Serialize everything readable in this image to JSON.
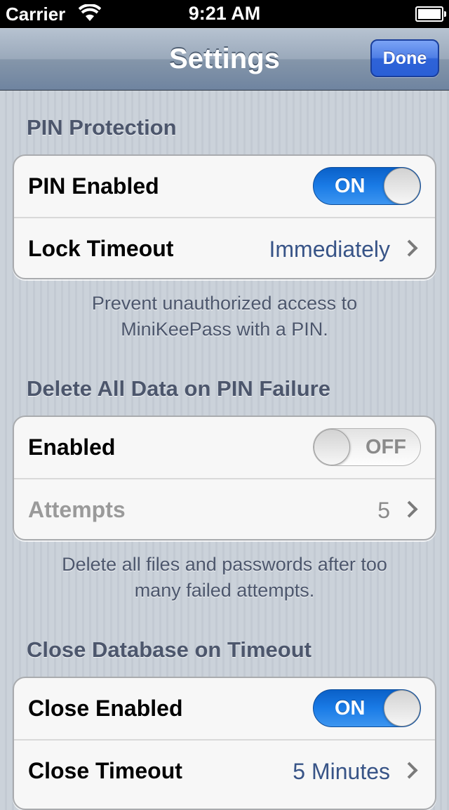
{
  "status_bar": {
    "carrier": "Carrier",
    "time": "9:21 AM",
    "wifi_icon": "wifi-icon",
    "battery_icon": "battery-icon"
  },
  "nav_bar": {
    "title": "Settings",
    "done_label": "Done"
  },
  "sections": {
    "pin": {
      "header": "PIN Protection",
      "pin_enabled_label": "PIN Enabled",
      "pin_enabled_state": "ON",
      "lock_timeout_label": "Lock Timeout",
      "lock_timeout_value": "Immediately",
      "footer_line1": "Prevent unauthorized access to",
      "footer_line2": "MiniKeePass with a PIN."
    },
    "delete": {
      "header": "Delete All Data on PIN Failure",
      "enabled_label": "Enabled",
      "enabled_state": "OFF",
      "attempts_label": "Attempts",
      "attempts_value": "5",
      "footer_line1": "Delete all files and passwords after too",
      "footer_line2": "many failed attempts."
    },
    "close": {
      "header": "Close Database on Timeout",
      "close_enabled_label": "Close Enabled",
      "close_enabled_state": "ON",
      "close_timeout_label": "Close Timeout",
      "close_timeout_value": "5 Minutes"
    }
  },
  "colors": {
    "accent_blue": "#2a5fd6",
    "switch_on": "#1a7be6",
    "value_text": "#385487",
    "section_header": "#4c566c"
  }
}
